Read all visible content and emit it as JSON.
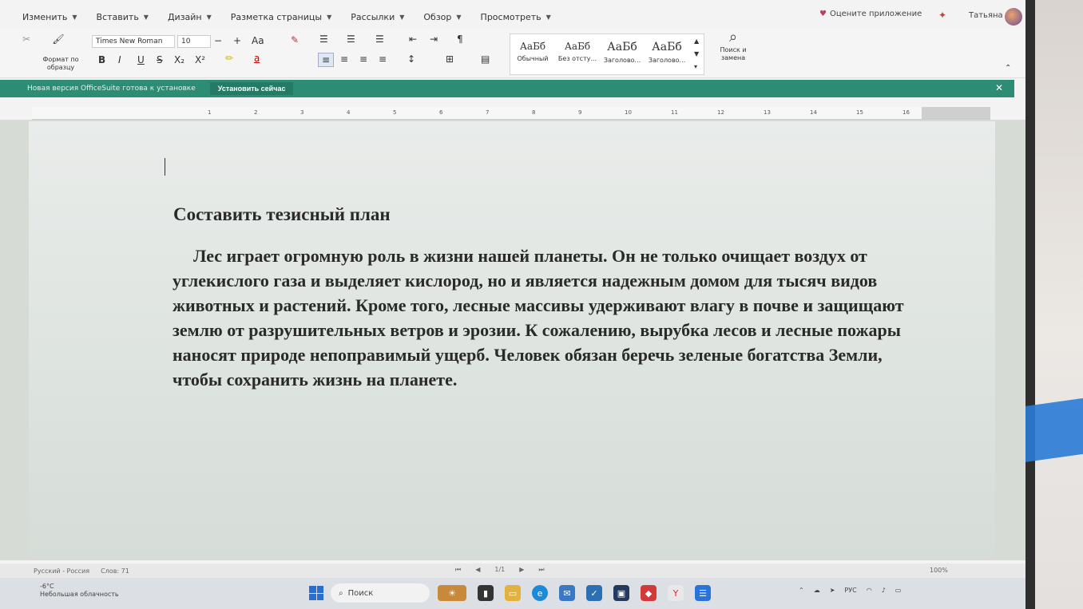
{
  "menu": {
    "items": [
      {
        "label": "Изменить"
      },
      {
        "label": "Вставить"
      },
      {
        "label": "Дизайн"
      },
      {
        "label": "Разметка страницы"
      },
      {
        "label": "Рассылки"
      },
      {
        "label": "Обзор"
      },
      {
        "label": "Просмотреть"
      }
    ],
    "rate_app": "Оцените приложение",
    "user_name": "Татьяна"
  },
  "ribbon": {
    "format_painter": "Формат по образцу",
    "font_name": "Times New Roman",
    "font_size": "10",
    "font_case": "Aa",
    "bold": "B",
    "italic": "I",
    "underline": "U",
    "strike": "S",
    "subscript": "X₂",
    "superscript": "X²",
    "pilcrow": "¶",
    "styles": [
      {
        "sample": "АаБб",
        "label": "Обычный"
      },
      {
        "sample": "АаБб",
        "label": "Без отсту..."
      },
      {
        "sample": "АаБб",
        "label": "Заголово..."
      },
      {
        "sample": "АаБб",
        "label": "Заголово..."
      }
    ],
    "find_replace": "Поиск и замена"
  },
  "update_bar": {
    "message": "Новая версия OfficeSuite готова к установке",
    "button": "Установить сейчас"
  },
  "ruler": {
    "numbers": [
      "1",
      "2",
      "3",
      "4",
      "5",
      "6",
      "7",
      "8",
      "9",
      "10",
      "11",
      "12",
      "13",
      "14",
      "15",
      "16"
    ]
  },
  "document": {
    "title": "Составить тезисный план",
    "body": "Лес играет огромную роль в жизни нашей планеты. Он не только очищает воздух от углекислого газа и выделяет кислород, но и является надежным домом для тысяч видов животных и растений. Кроме того, лесные массивы удерживают влагу в почве и защищают землю от разрушительных ветров и эрозии. К сожалению, вырубка лесов и лесные пожары наносят природе непоправимый ущерб. Человек обязан беречь зеленые богатства Земли, чтобы сохранить жизнь на планете."
  },
  "status": {
    "language": "Русский - Россия",
    "words": "Слов: 71",
    "page": "1/1",
    "zoom": "100%"
  },
  "taskbar": {
    "search_placeholder": "Поиск",
    "weather_temp": "-6°C",
    "weather_desc": "Небольшая облачность",
    "lang": "РУС"
  },
  "colors": {
    "update_bar": "#2c8c74",
    "accent": "#2a6fd0"
  }
}
